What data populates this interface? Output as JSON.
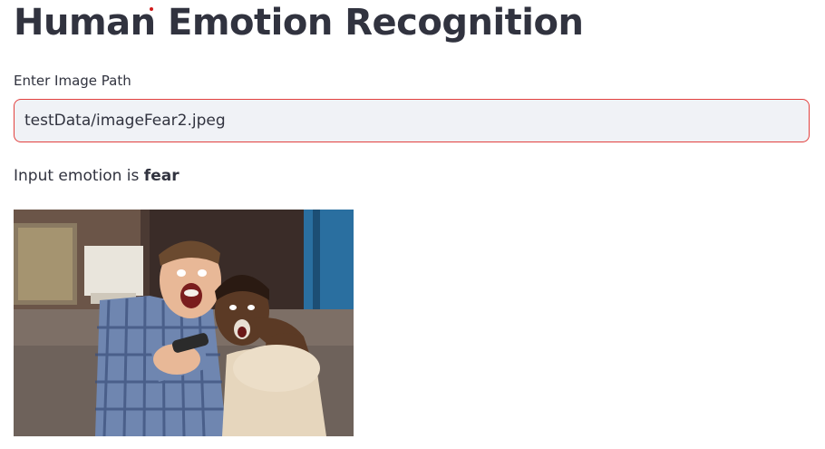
{
  "page": {
    "title": "Human Emotion Recognition"
  },
  "form": {
    "label": "Enter Image Path",
    "input_value": "testData/imageFear2.jpeg"
  },
  "result": {
    "prefix": "Input emotion is ",
    "emotion": "fear"
  },
  "image": {
    "alt": "Two people on a couch with frightened expressions, one holding a remote control"
  },
  "colors": {
    "text": "#31333F",
    "input_bg": "#f0f2f6",
    "input_border_focus": "#e2413f"
  }
}
